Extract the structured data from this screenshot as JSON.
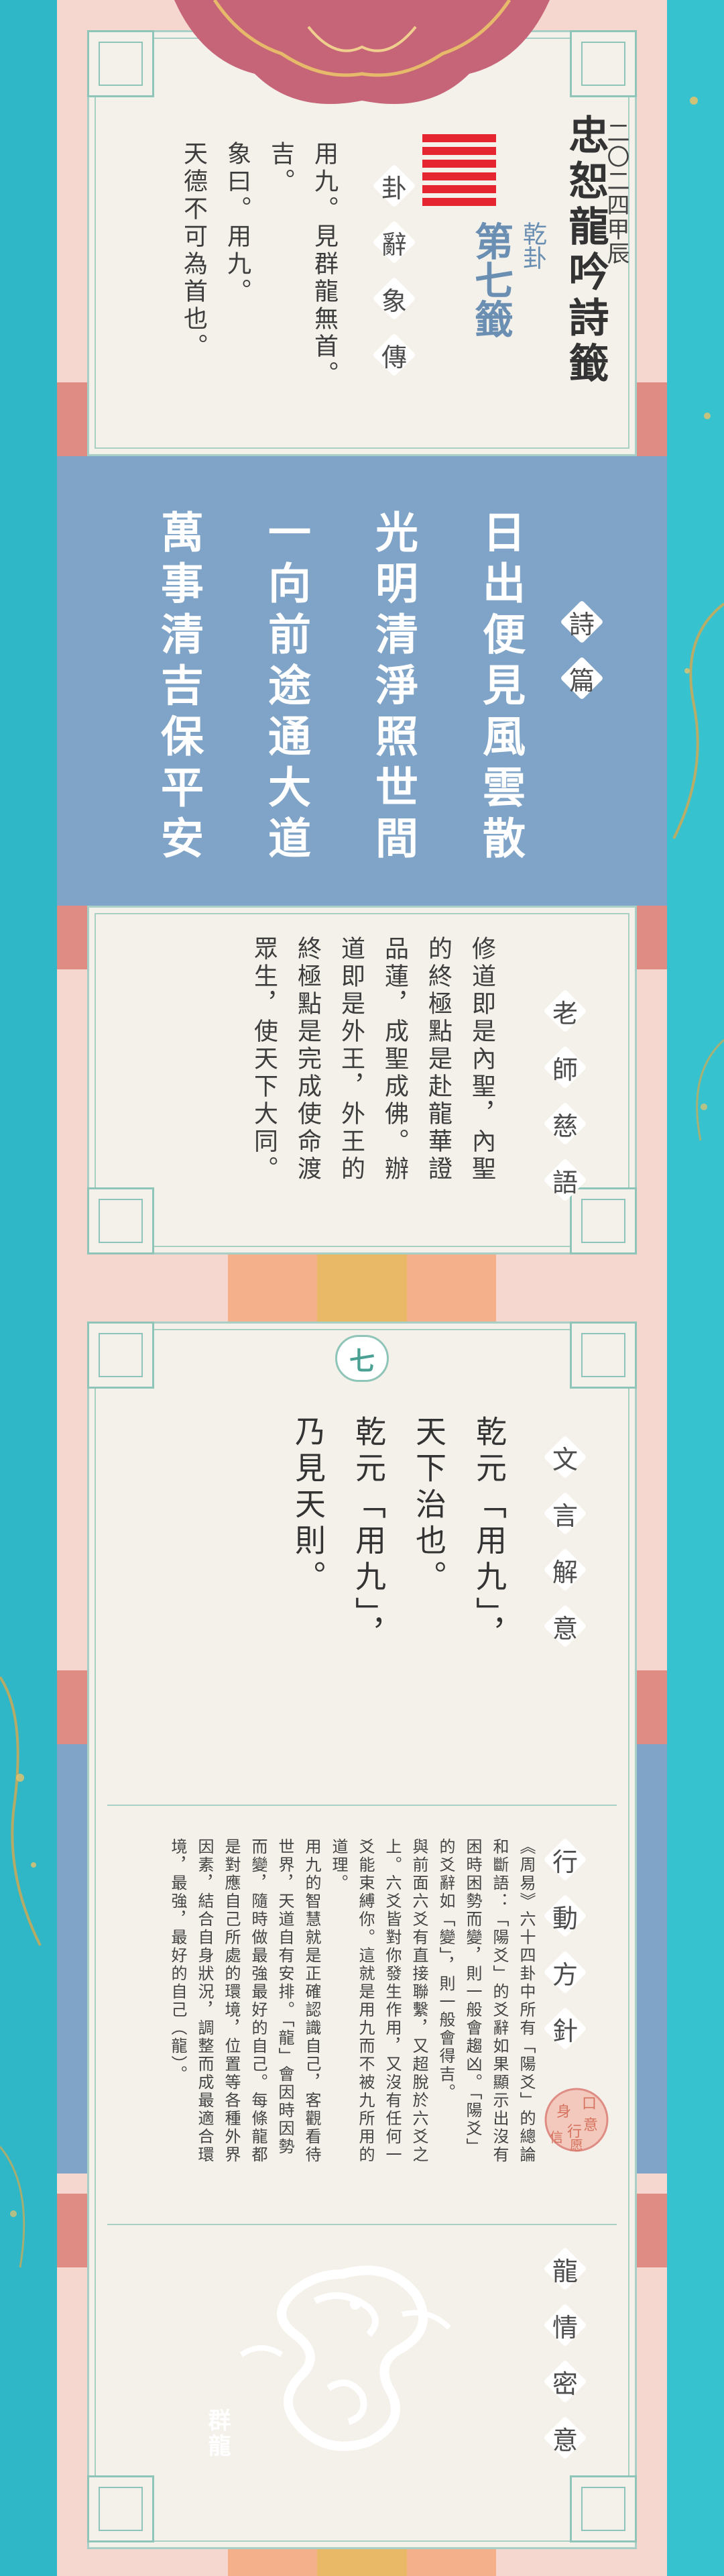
{
  "header": {
    "year": "二〇二四甲辰",
    "title": "忠恕龍吟詩籤",
    "hexagram": "乾卦",
    "lot_number": "第七籤",
    "section_label": [
      "卦",
      "辭",
      "象",
      "傳"
    ],
    "lines": [
      "用九。見群龍無首。",
      "吉。",
      "象曰。用九。",
      "天德不可為首也。"
    ]
  },
  "poem": {
    "label": [
      "詩",
      "篇"
    ],
    "lines": [
      "日出便見風雲散",
      "光明清淨照世間",
      "一向前途通大道",
      "萬事清吉保平安"
    ]
  },
  "teacher": {
    "label": [
      "老",
      "師",
      "慈",
      "語"
    ],
    "lines": [
      "修道即是內聖，內聖",
      "的終極點是赴龍華證",
      "品蓮，成聖成佛。辦",
      "道即是外王，外王的",
      "終極點是完成使命渡",
      "眾生，使天下大同。"
    ]
  },
  "wenyan": {
    "badge": "七",
    "label": [
      "文",
      "言",
      "解",
      "意"
    ],
    "lines": [
      "乾元「用九」，",
      "天下治也。",
      "乾元「用九」，",
      "乃見天則。"
    ]
  },
  "action": {
    "label": [
      "行",
      "動",
      "方",
      "針"
    ],
    "stamp": [
      "口",
      "身",
      "意",
      "行",
      "信",
      "愿"
    ],
    "lines": [
      "《周易》六十四卦中所有「陽爻」的總論",
      "和斷語：「陽爻」的爻辭如果顯示出沒有",
      "困時困勢而變，則一般會趨凶。「陽爻」",
      "的爻辭如「變」，則一般會得吉。",
      "與前面六爻有直接聯繫，又超脫於六爻之",
      "上。六爻皆對你發生作用，又沒有任何一",
      "爻能束縛你。這就是用九而不被九所用的",
      "道理。",
      "用九的智慧就是正確認識自己，客觀看待",
      "世界，天道自有安排。「龍」會因時因勢",
      "而變，隨時做最強最好的自己。每條龍都",
      "是對應自己所處的環境，位置等各種外界",
      "因素，結合自身狀況，調整而成最適合環",
      "境，最強，最好的自己（龍）。"
    ]
  },
  "dragon": {
    "label": [
      "龍",
      "情",
      "密",
      "意"
    ],
    "caption": "群龍"
  },
  "colors": {
    "pink": "#f6d7cf",
    "blue": "#7fa4c7",
    "red": "#e52630",
    "teal": "#8fc4b8",
    "coral": "#df8d84",
    "gold": "#e9b968"
  }
}
